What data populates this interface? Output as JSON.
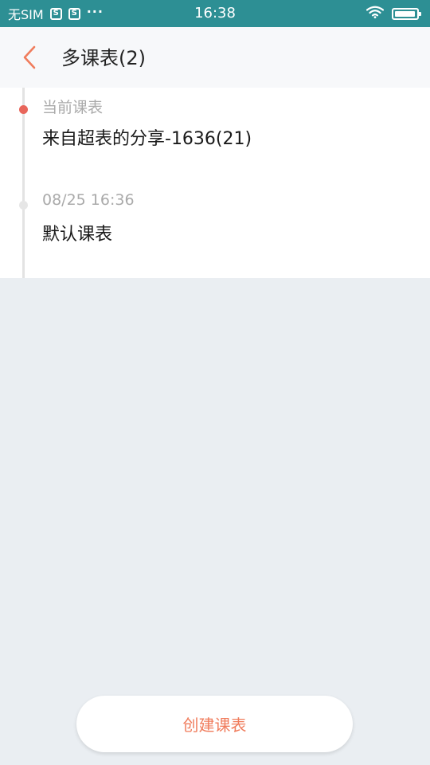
{
  "status_bar": {
    "carrier": "无SIM",
    "icon_1": "S",
    "icon_2": "S",
    "more": "···",
    "time": "16:38",
    "battery_level": 0.95
  },
  "header": {
    "title": "多课表(2)"
  },
  "timeline": {
    "items": [
      {
        "meta": "当前课表",
        "name": "来自超表的分享-1636(21)",
        "dot_color": "#e8665b"
      },
      {
        "meta": "08/25 16:36",
        "name": "默认课表",
        "dot_color": "#e6e6e6"
      }
    ]
  },
  "actions": {
    "create_label": "创建课表"
  },
  "colors": {
    "status_bar": "#2d8f94",
    "accent": "#f07c5c",
    "background": "#eaeef2"
  }
}
